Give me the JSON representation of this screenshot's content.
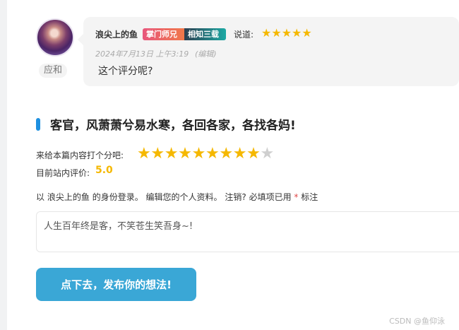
{
  "comment": {
    "avatar_name": "应和",
    "author": "浪尖上的鱼",
    "badges": [
      "掌门师兄",
      "相知三载"
    ],
    "said": "说道:",
    "stars": "★★★★★",
    "date": "2024年7月13日 上午3:19",
    "edit": "(编辑)",
    "text": "这个评分呢?"
  },
  "reply": {
    "title": "客官，风萧萧兮易水寒，各回各家，各找各妈!",
    "rate_label": "来给本篇内容打个分吧:",
    "rating": {
      "filled": 9,
      "total": 10
    },
    "score_label": "目前站内评价:",
    "score_value": "5.0",
    "login": {
      "prefix": "以",
      "user": "浪尖上的鱼",
      "mid": "的身份登录。",
      "edit_profile": "编辑您的个人资料。",
      "logout": "注销?",
      "required_note": "必填项已用",
      "asterisk": "*",
      "mark": "标注"
    },
    "textarea_value": "人生百年终是客，不笑苍生笑吾身~!",
    "submit_label": "点下去，发布你的想法!"
  },
  "watermark": "CSDN @鱼仰泳",
  "colors": {
    "star": "#f5b800",
    "accent": "#1e90e0",
    "button": "#3aa7d6"
  }
}
